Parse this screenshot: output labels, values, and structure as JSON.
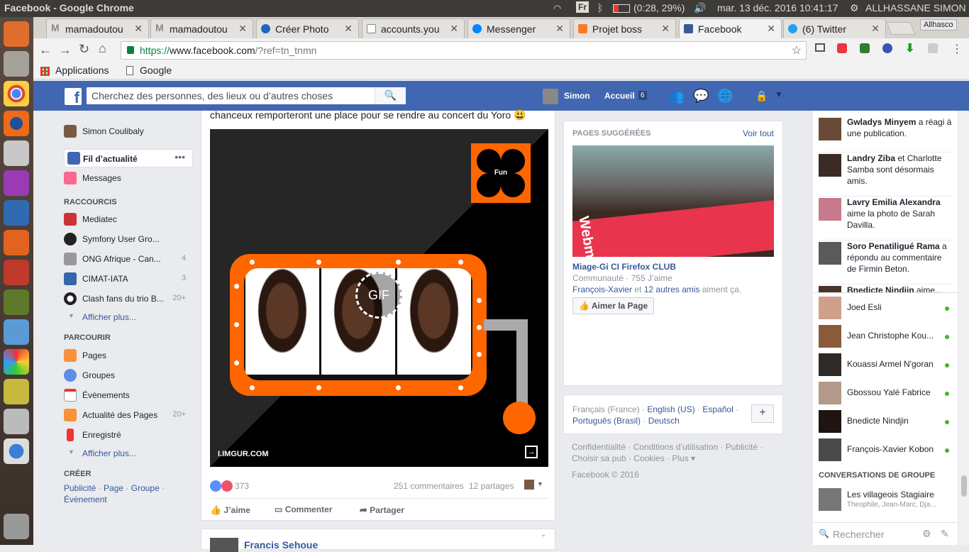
{
  "system": {
    "window_title": "Facebook - Google Chrome",
    "keyboard": "Fr",
    "battery": "(0:28, 29%)",
    "datetime": "mar. 13 déc. 2016 10:41:17",
    "user": "ALLHASSANE SIMON"
  },
  "browser": {
    "tabs": [
      {
        "label": "mamadoutou",
        "icon": "gmail-icon"
      },
      {
        "label": "mamadoutou",
        "icon": "gmail-icon"
      },
      {
        "label": "Créer Photo",
        "icon": "edge-icon"
      },
      {
        "label": "accounts.you",
        "icon": "page-icon"
      },
      {
        "label": "Messenger",
        "icon": "messenger-icon"
      },
      {
        "label": "Projet boss",
        "icon": "xampp-icon"
      },
      {
        "label": "Facebook",
        "icon": "facebook-icon"
      },
      {
        "label": "(6) Twitter",
        "icon": "twitter-icon"
      }
    ],
    "profile_label": "Allhasco",
    "url_scheme": "https://",
    "url_host": "www.facebook.com",
    "url_path": "/?ref=tn_tnmn",
    "bookmarks": [
      "Applications",
      "Google"
    ]
  },
  "fb_header": {
    "search_placeholder": "Cherchez des personnes, des lieux ou d’autres choses",
    "profile_name": "Simon",
    "home_label": "Accueil",
    "home_count": "6"
  },
  "left_nav": {
    "profile": "Simon Coulibaly",
    "news_feed": "Fil d’actualité",
    "messages": "Messages",
    "shortcuts_title": "RACCOURCIS",
    "shortcuts": [
      {
        "label": "Mediatec",
        "count": ""
      },
      {
        "label": "Symfony User Gro...",
        "count": ""
      },
      {
        "label": "ONG Afrique - Can...",
        "count": "4"
      },
      {
        "label": "CIMAT-IATA",
        "count": "3"
      },
      {
        "label": "Clash fans du trio B...",
        "count": "20+"
      }
    ],
    "show_more": "Afficher plus...",
    "explore_title": "PARCOURIR",
    "explore": [
      {
        "label": "Pages",
        "count": ""
      },
      {
        "label": "Groupes",
        "count": ""
      },
      {
        "label": "Évènements",
        "count": ""
      },
      {
        "label": "Actualité des Pages",
        "count": "20+"
      },
      {
        "label": "Enregistré",
        "count": ""
      }
    ],
    "show_more2": "Afficher plus...",
    "create_title": "CRÉER",
    "create_links": [
      "Publicité",
      "Page",
      "Groupe",
      "Évènement"
    ]
  },
  "post": {
    "text_tail": "chanceux remporteront une place pour se rendre au concert du Yoro 😃",
    "badge": "Fun",
    "gif_label": "GIF",
    "source": "I.IMGUR.COM",
    "reactions_count": "373",
    "comments": "251 commentaires",
    "shares": "12 partages",
    "like": "J’aime",
    "comment": "Commenter",
    "share": "Partager",
    "next_author": "Francis Sehoue"
  },
  "suggested": {
    "title": "PAGES SUGGÉRÉES",
    "see_all": "Voir tout",
    "page_name": "Miage-Gi CI Firefox CLUB",
    "meta": "Communauté · 755 J’aime",
    "friend_link": "François-Xavier",
    "friends_mid": " et ",
    "friends_more": "12 autres amis",
    "friends_tail": " aiment ça.",
    "like_page": "Aimer la Page",
    "image_text": "Webma"
  },
  "languages": {
    "current": "Français (France) · ",
    "links": [
      "English (US)",
      "Español",
      "Português (Brasil)",
      "Deutsch"
    ],
    "add": "+"
  },
  "footer": {
    "links_line1": "Confidentialité · Conditions d’utilisation · Publicité ·",
    "links_line2": "Choisir sa pub · Cookies · Plus ▾",
    "copyright": "Facebook © 2016"
  },
  "ticker": [
    {
      "bold": "Gwladys Minyem",
      "rest": " a réagi à une publication."
    },
    {
      "bold": "Landry Ziba",
      "rest": " et Charlotte Samba sont désormais amis."
    },
    {
      "bold": "Lavry Emilia Alexandra",
      "rest": " aime la photo de Sarah Davilla."
    },
    {
      "bold": "Soro Penatiligué Rama",
      "rest": " a répondu au commentaire de Firmin Beton."
    },
    {
      "bold": "Bnedicte Nindjin",
      "rest": " aime..."
    }
  ],
  "chat": {
    "contacts": [
      "Joed Esli",
      "Jean Christophe Kou...",
      "Kouassi Armel N'goran",
      "Gbossou Yalé Fabrice",
      "Bnedicte Nindjin",
      "François-Xavier Kobon"
    ],
    "groups_title": "CONVERSATIONS DE GROUPE",
    "group_name": "Les villageois Stagiaire",
    "group_members": "Theophile, Jean-Marc, Dja...",
    "search_placeholder": "Rechercher"
  },
  "colors": {
    "fb_blue": "#4267b2",
    "link": "#365899",
    "online": "#42b72a",
    "orange": "#ff6600"
  }
}
